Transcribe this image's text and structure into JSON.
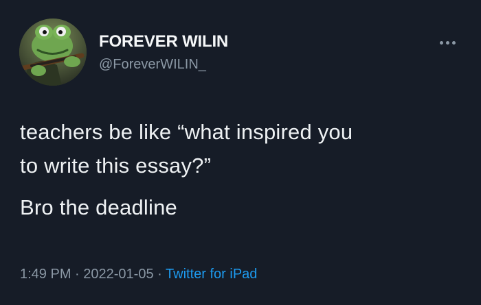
{
  "tweet": {
    "author": {
      "display_name": "FOREVER WILIN",
      "handle": "@ForeverWILIN_",
      "avatar_icon": "frog-avatar-icon"
    },
    "more_icon": "more-horizontal-icon",
    "text": {
      "line1": "teachers be like “what inspired you",
      "line2": "to write this essay?”",
      "line3": "Bro the deadline"
    },
    "meta": {
      "time": "1:49 PM",
      "separator_1": "·",
      "date": "2022-01-05",
      "separator_2": "·",
      "source": "Twitter for iPad"
    },
    "colors": {
      "background": "#161c27",
      "text": "#eef1f3",
      "secondary_text": "#8b98a5",
      "link": "#1d9bf0"
    }
  }
}
